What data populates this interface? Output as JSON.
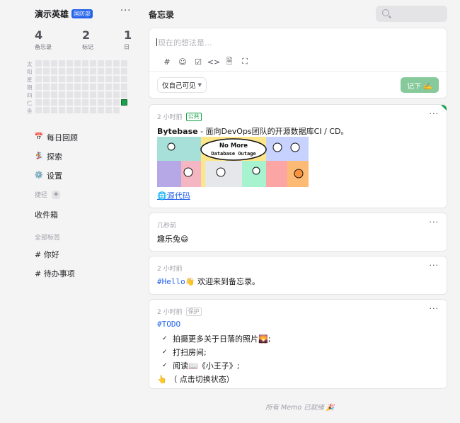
{
  "profile": {
    "name": "演示英雄",
    "badge": "国防部",
    "more": "···"
  },
  "stats": [
    {
      "value": "4",
      "label": "备忘录"
    },
    {
      "value": "2",
      "label": "标记"
    },
    {
      "value": "1",
      "label": "日"
    }
  ],
  "heatmap": {
    "weekdays": [
      "太",
      "阳",
      "星",
      "期",
      "四",
      "仁",
      "坐"
    ]
  },
  "nav": [
    {
      "label": "每日回顾",
      "icon": "calendar-icon",
      "glyph": "📅"
    },
    {
      "label": "探索",
      "icon": "explore-icon",
      "glyph": "🏂"
    },
    {
      "label": "设置",
      "icon": "gear-icon",
      "glyph": "⚙️"
    }
  ],
  "shortcuts": {
    "title": "捷径",
    "plus": "+",
    "inbox": "收件箱"
  },
  "tags": {
    "title": "全部标签",
    "items": [
      "# 你好",
      "# 待办事项"
    ]
  },
  "main": {
    "title": "备忘录"
  },
  "search": {
    "placeholder": ""
  },
  "editor": {
    "placeholder": "现在的想法是...",
    "tools": [
      {
        "icon": "hashtag-icon",
        "glyph": "#"
      },
      {
        "icon": "emoji-icon",
        "glyph": "☺"
      },
      {
        "icon": "checkbox-icon",
        "glyph": "☑"
      },
      {
        "icon": "code-icon",
        "glyph": "<>"
      },
      {
        "icon": "file-icon",
        "glyph": "🗎"
      },
      {
        "icon": "fullscreen-icon",
        "glyph": "⛶"
      }
    ],
    "visibility": "仅自己可见",
    "save_label": "记下 ✍️"
  },
  "memos": [
    {
      "time": "2 小时前",
      "tag": "公共",
      "title": "Bytebase",
      "text": " - 面向DevOps团队的开源数据库CI / CD。",
      "banner_text_1": "No More",
      "banner_text_2": "Database Outage",
      "link": "🌐源代码"
    },
    {
      "time": "几秒前",
      "text": "趣乐兔😄"
    },
    {
      "time": "2 小时前",
      "hashtag": "#Hello",
      "text": "👋 欢迎来到备忘录。"
    },
    {
      "time": "2 小时前",
      "tag": "保护",
      "hashtag": "#TODO",
      "todos": [
        "拍摄更多关于日落的照片🌄;",
        "打扫房间;",
        "阅读📖《小王子》;"
      ],
      "note": "👆 （ 点击切换状态）"
    }
  ],
  "footer": "所有 Memo 已就绪 🎉",
  "colors": {
    "accent": "#16a34a",
    "link": "#2563eb",
    "badge": "#2563eb",
    "save": "#86c99a"
  }
}
